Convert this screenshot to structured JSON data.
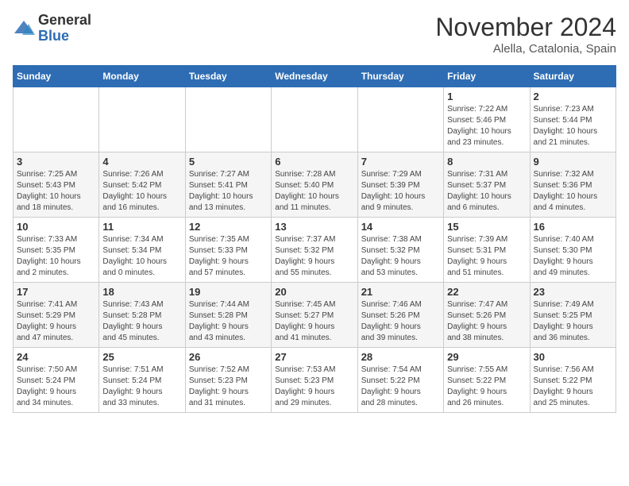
{
  "logo": {
    "line1": "General",
    "line2": "Blue"
  },
  "title": "November 2024",
  "subtitle": "Alella, Catalonia, Spain",
  "days_header": [
    "Sunday",
    "Monday",
    "Tuesday",
    "Wednesday",
    "Thursday",
    "Friday",
    "Saturday"
  ],
  "weeks": [
    [
      {
        "day": "",
        "info": ""
      },
      {
        "day": "",
        "info": ""
      },
      {
        "day": "",
        "info": ""
      },
      {
        "day": "",
        "info": ""
      },
      {
        "day": "",
        "info": ""
      },
      {
        "day": "1",
        "info": "Sunrise: 7:22 AM\nSunset: 5:46 PM\nDaylight: 10 hours\nand 23 minutes."
      },
      {
        "day": "2",
        "info": "Sunrise: 7:23 AM\nSunset: 5:44 PM\nDaylight: 10 hours\nand 21 minutes."
      }
    ],
    [
      {
        "day": "3",
        "info": "Sunrise: 7:25 AM\nSunset: 5:43 PM\nDaylight: 10 hours\nand 18 minutes."
      },
      {
        "day": "4",
        "info": "Sunrise: 7:26 AM\nSunset: 5:42 PM\nDaylight: 10 hours\nand 16 minutes."
      },
      {
        "day": "5",
        "info": "Sunrise: 7:27 AM\nSunset: 5:41 PM\nDaylight: 10 hours\nand 13 minutes."
      },
      {
        "day": "6",
        "info": "Sunrise: 7:28 AM\nSunset: 5:40 PM\nDaylight: 10 hours\nand 11 minutes."
      },
      {
        "day": "7",
        "info": "Sunrise: 7:29 AM\nSunset: 5:39 PM\nDaylight: 10 hours\nand 9 minutes."
      },
      {
        "day": "8",
        "info": "Sunrise: 7:31 AM\nSunset: 5:37 PM\nDaylight: 10 hours\nand 6 minutes."
      },
      {
        "day": "9",
        "info": "Sunrise: 7:32 AM\nSunset: 5:36 PM\nDaylight: 10 hours\nand 4 minutes."
      }
    ],
    [
      {
        "day": "10",
        "info": "Sunrise: 7:33 AM\nSunset: 5:35 PM\nDaylight: 10 hours\nand 2 minutes."
      },
      {
        "day": "11",
        "info": "Sunrise: 7:34 AM\nSunset: 5:34 PM\nDaylight: 10 hours\nand 0 minutes."
      },
      {
        "day": "12",
        "info": "Sunrise: 7:35 AM\nSunset: 5:33 PM\nDaylight: 9 hours\nand 57 minutes."
      },
      {
        "day": "13",
        "info": "Sunrise: 7:37 AM\nSunset: 5:32 PM\nDaylight: 9 hours\nand 55 minutes."
      },
      {
        "day": "14",
        "info": "Sunrise: 7:38 AM\nSunset: 5:32 PM\nDaylight: 9 hours\nand 53 minutes."
      },
      {
        "day": "15",
        "info": "Sunrise: 7:39 AM\nSunset: 5:31 PM\nDaylight: 9 hours\nand 51 minutes."
      },
      {
        "day": "16",
        "info": "Sunrise: 7:40 AM\nSunset: 5:30 PM\nDaylight: 9 hours\nand 49 minutes."
      }
    ],
    [
      {
        "day": "17",
        "info": "Sunrise: 7:41 AM\nSunset: 5:29 PM\nDaylight: 9 hours\nand 47 minutes."
      },
      {
        "day": "18",
        "info": "Sunrise: 7:43 AM\nSunset: 5:28 PM\nDaylight: 9 hours\nand 45 minutes."
      },
      {
        "day": "19",
        "info": "Sunrise: 7:44 AM\nSunset: 5:28 PM\nDaylight: 9 hours\nand 43 minutes."
      },
      {
        "day": "20",
        "info": "Sunrise: 7:45 AM\nSunset: 5:27 PM\nDaylight: 9 hours\nand 41 minutes."
      },
      {
        "day": "21",
        "info": "Sunrise: 7:46 AM\nSunset: 5:26 PM\nDaylight: 9 hours\nand 39 minutes."
      },
      {
        "day": "22",
        "info": "Sunrise: 7:47 AM\nSunset: 5:26 PM\nDaylight: 9 hours\nand 38 minutes."
      },
      {
        "day": "23",
        "info": "Sunrise: 7:49 AM\nSunset: 5:25 PM\nDaylight: 9 hours\nand 36 minutes."
      }
    ],
    [
      {
        "day": "24",
        "info": "Sunrise: 7:50 AM\nSunset: 5:24 PM\nDaylight: 9 hours\nand 34 minutes."
      },
      {
        "day": "25",
        "info": "Sunrise: 7:51 AM\nSunset: 5:24 PM\nDaylight: 9 hours\nand 33 minutes."
      },
      {
        "day": "26",
        "info": "Sunrise: 7:52 AM\nSunset: 5:23 PM\nDaylight: 9 hours\nand 31 minutes."
      },
      {
        "day": "27",
        "info": "Sunrise: 7:53 AM\nSunset: 5:23 PM\nDaylight: 9 hours\nand 29 minutes."
      },
      {
        "day": "28",
        "info": "Sunrise: 7:54 AM\nSunset: 5:22 PM\nDaylight: 9 hours\nand 28 minutes."
      },
      {
        "day": "29",
        "info": "Sunrise: 7:55 AM\nSunset: 5:22 PM\nDaylight: 9 hours\nand 26 minutes."
      },
      {
        "day": "30",
        "info": "Sunrise: 7:56 AM\nSunset: 5:22 PM\nDaylight: 9 hours\nand 25 minutes."
      }
    ]
  ]
}
